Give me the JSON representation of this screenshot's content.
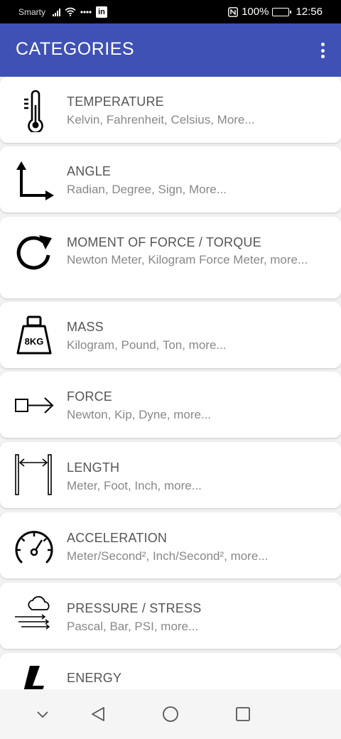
{
  "status_bar": {
    "carrier": "Smarty",
    "battery": "100%",
    "time": "12:56",
    "battery_level": 1.0
  },
  "app_bar": {
    "title": "CATEGORIES",
    "menu_icon": "more-vert-icon"
  },
  "categories": [
    {
      "title": "TEMPERATURE",
      "subtitle": "Kelvin, Fahrenheit, Celsius, More...",
      "icon": "thermometer-icon"
    },
    {
      "title": "ANGLE",
      "subtitle": "Radian, Degree, Sign, More...",
      "icon": "angle-icon"
    },
    {
      "title": "MOMENT OF FORCE / TORQUE",
      "subtitle": "Newton Meter, Kilogram Force Meter, more...",
      "icon": "rotate-icon"
    },
    {
      "title": "MASS",
      "subtitle": "Kilogram, Pound, Ton, more...",
      "icon": "weight-icon",
      "icon_label": "8KG"
    },
    {
      "title": "FORCE",
      "subtitle": "Newton, Kip, Dyne, more...",
      "icon": "force-icon"
    },
    {
      "title": "LENGTH",
      "subtitle": "Meter, Foot, Inch, more...",
      "icon": "length-icon"
    },
    {
      "title": "ACCELERATION",
      "subtitle": "Meter/Second², Inch/Second², more...",
      "icon": "speedometer-icon"
    },
    {
      "title": "PRESSURE / STRESS",
      "subtitle": "Pascal, Bar, PSI, more...",
      "icon": "pressure-icon"
    },
    {
      "title": "ENERGY",
      "subtitle": "",
      "icon": "lightning-icon"
    }
  ],
  "nav_bar": {
    "items": [
      "chevron-down-icon",
      "back-icon",
      "home-icon",
      "recents-icon"
    ]
  }
}
